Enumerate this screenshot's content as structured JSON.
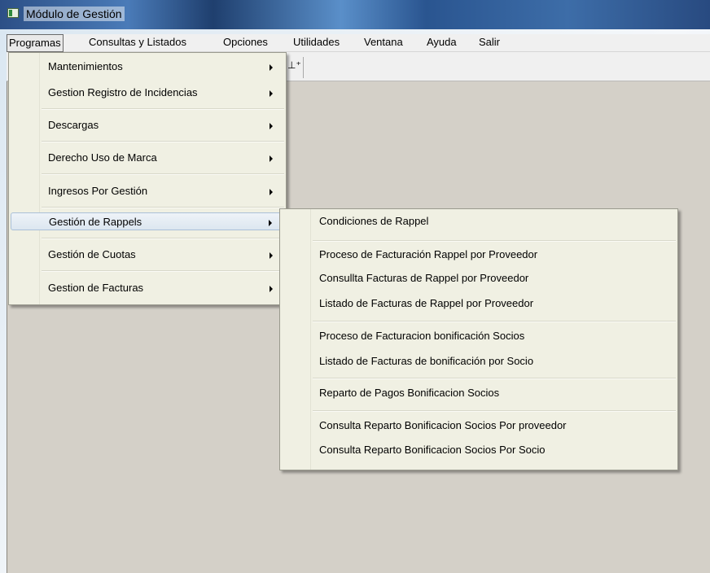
{
  "window": {
    "title": "Módulo de Gestión"
  },
  "menubar": {
    "items": [
      {
        "label": "Programas"
      },
      {
        "label": "Consultas y Listados"
      },
      {
        "label": "Opciones"
      },
      {
        "label": "Utilidades"
      },
      {
        "label": "Ventana"
      },
      {
        "label": "Ayuda"
      },
      {
        "label": "Salir"
      }
    ]
  },
  "programas_menu": {
    "items": [
      {
        "label": "Mantenimientos"
      },
      {
        "label": "Gestion Registro de Incidencias"
      },
      {
        "label": "Descargas"
      },
      {
        "label": "Derecho Uso de Marca"
      },
      {
        "label": "Ingresos Por Gestión"
      },
      {
        "label": "Gestión de Rappels"
      },
      {
        "label": "Gestión de Cuotas"
      },
      {
        "label": "Gestion de Facturas"
      }
    ]
  },
  "rappels_submenu": {
    "items": [
      {
        "label": "Condiciones de Rappel"
      },
      {
        "label": "Proceso de Facturación Rappel por Proveedor"
      },
      {
        "label": "Consullta Facturas de Rappel por Proveedor"
      },
      {
        "label": "Listado de Facturas de Rappel por Proveedor"
      },
      {
        "label": "Proceso de Facturacion  bonificación Socios"
      },
      {
        "label": "Listado de Facturas de bonificación por Socio"
      },
      {
        "label": "Reparto de Pagos Bonificacion Socios"
      },
      {
        "label": "Consulta Reparto Bonificacion Socios Por proveedor"
      },
      {
        "label": "Consulta Reparto Bonificacion Socios Por Socio"
      }
    ]
  },
  "toolbar": {
    "icon": "toolbar-add-icon"
  },
  "colors": {
    "menu_bg": "#f0f0e3",
    "client_bg": "#d4d0c8",
    "hover_bg": "#dce6f0",
    "titlebar": "#2c4f86"
  }
}
